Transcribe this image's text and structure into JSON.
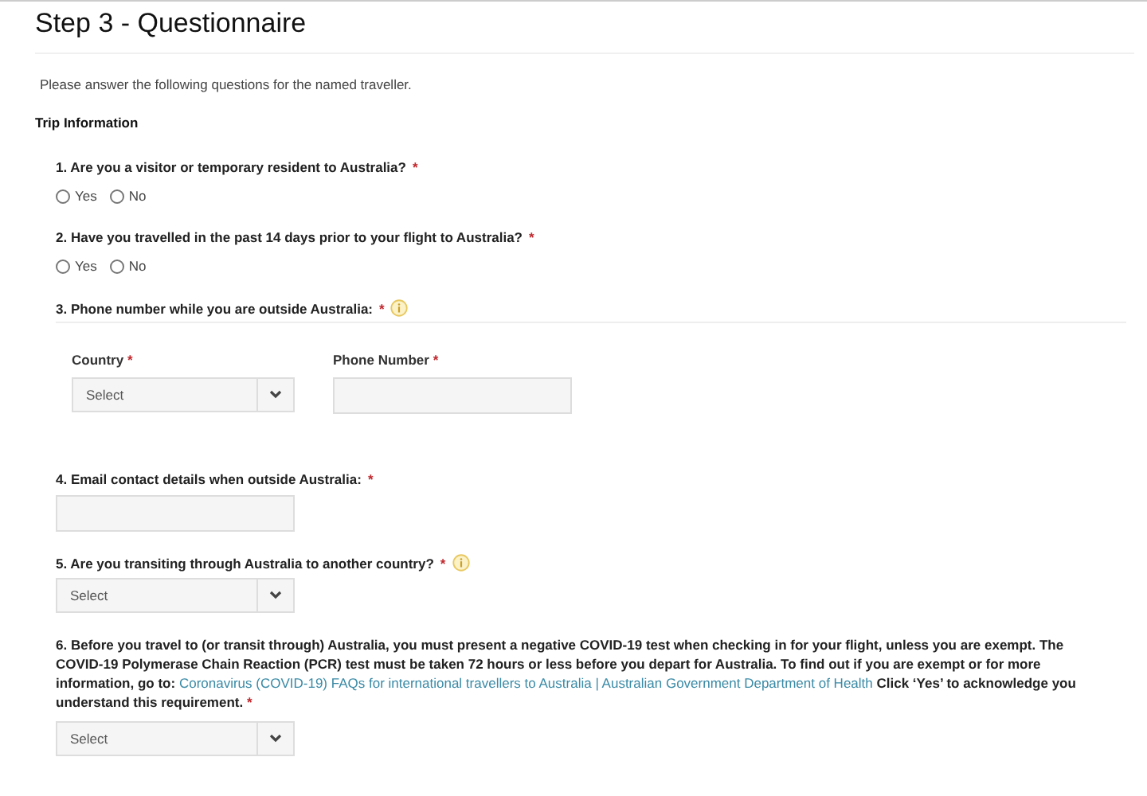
{
  "title": "Step 3 - Questionnaire",
  "intro": "Please answer the following questions for the named traveller.",
  "section": "Trip Information",
  "required_mark": "*",
  "questions": [
    {
      "kind": "radio",
      "label": "1. Are you a visitor or temporary resident to Australia?",
      "required": true,
      "info": false,
      "options": [
        {
          "label": "Yes",
          "selected": false
        },
        {
          "label": "No",
          "selected": false
        }
      ]
    },
    {
      "kind": "radio",
      "label": "2. Have you travelled in the past 14 days prior to your flight to Australia?",
      "required": true,
      "info": false,
      "options": [
        {
          "label": "Yes",
          "selected": false
        },
        {
          "label": "No",
          "selected": false
        }
      ]
    },
    {
      "kind": "phone",
      "label": "3. Phone number while you are outside Australia:",
      "required": true,
      "info": true,
      "fields": [
        {
          "kind": "select",
          "label": "Country",
          "required": true,
          "placeholder": "Select"
        },
        {
          "kind": "text",
          "label": "Phone Number",
          "required": true
        }
      ]
    },
    {
      "kind": "text",
      "label": "4. Email contact details when outside Australia:",
      "required": true,
      "info": false
    },
    {
      "kind": "select",
      "label": "5. Are you transiting through Australia to another country?",
      "required": true,
      "info": true,
      "placeholder": "Select"
    },
    {
      "kind": "select",
      "label": "6. Before you travel to (or transit through) Australia, you must present a negative COVID-19 test when checking in for your flight, unless you are exempt. The COVID-19 Polymerase Chain Reaction (PCR) test must be taken 72 hours or less before you depart for Australia. To find out if you are exempt or for more information, go to:",
      "link": "Coronavirus (COVID-19) FAQs for international travellers to Australia | Australian Government Department of Health",
      "label_after": "Click ‘Yes’ to acknowledge you understand this requirement.",
      "required": true,
      "info": false,
      "placeholder": "Select"
    }
  ]
}
